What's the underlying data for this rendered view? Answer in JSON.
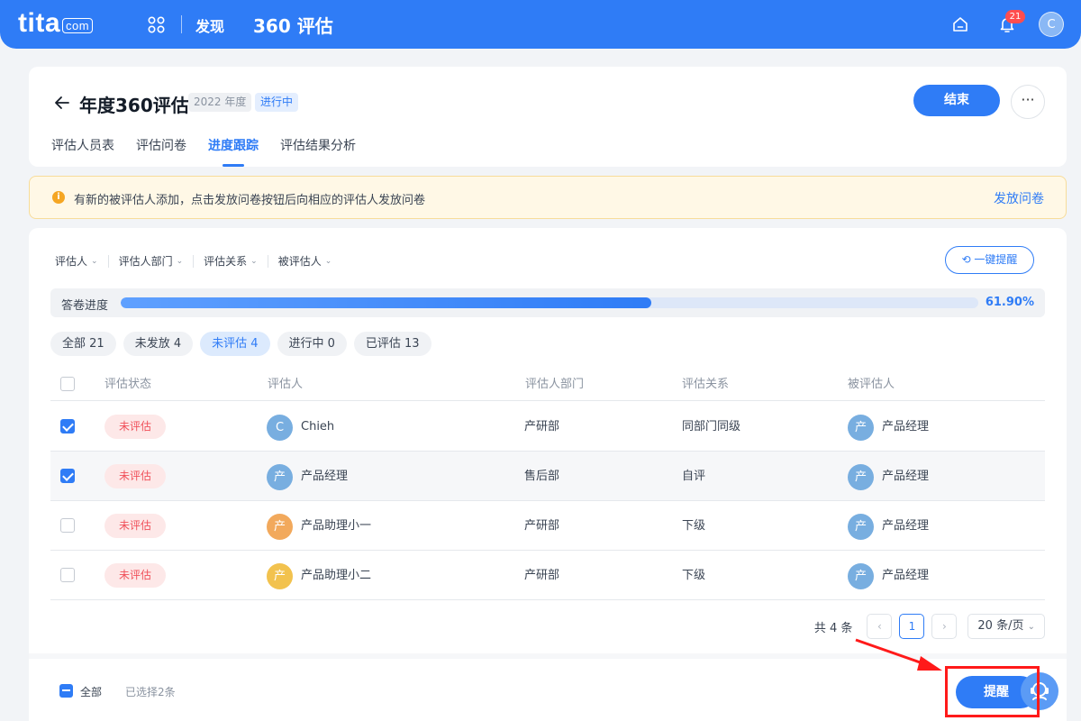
{
  "topbar": {
    "logo": "tita",
    "logo_suffix": "com",
    "discover": "发现",
    "title": "360 评估",
    "notification_count": "21",
    "avatar_initial": "C",
    "brand_color": "#2f7cf6"
  },
  "header": {
    "title": "年度360评估",
    "year_tag": "2022 年度",
    "status_tag": "进行中",
    "end_button": "结束",
    "more_button": "···",
    "tabs": [
      {
        "label": "评估人员表"
      },
      {
        "label": "评估问卷"
      },
      {
        "label": "进度跟踪"
      },
      {
        "label": "评估结果分析"
      }
    ],
    "active_tab": "进度跟踪"
  },
  "notice": {
    "icon": "i",
    "text": "有新的被评估人添加，点击发放问卷按钮后向相应的评估人发放问卷",
    "link": "发放问卷"
  },
  "filters": [
    {
      "label": "评估人"
    },
    {
      "label": "评估人部门"
    },
    {
      "label": "评估关系"
    },
    {
      "label": "被评估人"
    }
  ],
  "remind_all_button": "一键提醒",
  "progress": {
    "label": "答卷进度",
    "value_text": "61.90%",
    "fraction": 0.619
  },
  "status_chips": [
    {
      "label": "全部 21"
    },
    {
      "label": "未发放 4"
    },
    {
      "label": "未评估 4"
    },
    {
      "label": "进行中 0"
    },
    {
      "label": "已评估 13"
    }
  ],
  "active_chip": "未评估 4",
  "table": {
    "columns": [
      "评估状态",
      "评估人",
      "评估人部门",
      "评估关系",
      "被评估人"
    ],
    "rows": [
      {
        "checked": true,
        "status": "未评估",
        "evaluator": "Chieh",
        "evaluator_initial": "C",
        "evaluator_color": "#78aee0",
        "department": "产研部",
        "relation": "同部门同级",
        "evaluatee": "产品经理",
        "evaluatee_initial": "产"
      },
      {
        "checked": true,
        "status": "未评估",
        "evaluator": "产品经理",
        "evaluator_initial": "产",
        "evaluator_color": "#78aee0",
        "department": "售后部",
        "relation": "自评",
        "evaluatee": "产品经理",
        "evaluatee_initial": "产"
      },
      {
        "checked": false,
        "status": "未评估",
        "evaluator": "产品助理小一",
        "evaluator_initial": "产",
        "evaluator_color": "#f2a95c",
        "department": "产研部",
        "relation": "下级",
        "evaluatee": "产品经理",
        "evaluatee_initial": "产"
      },
      {
        "checked": false,
        "status": "未评估",
        "evaluator": "产品助理小二",
        "evaluator_initial": "产",
        "evaluator_color": "#f2c24e",
        "department": "产研部",
        "relation": "下级",
        "evaluatee": "产品经理",
        "evaluatee_initial": "产"
      }
    ]
  },
  "pagination": {
    "total": "共 4 条",
    "prev": "‹",
    "current_page": "1",
    "next": "›",
    "page_size": "20 条/页"
  },
  "footer": {
    "select_all": "全部",
    "selected_count": "已选择2条",
    "remind_button": "提醒"
  }
}
